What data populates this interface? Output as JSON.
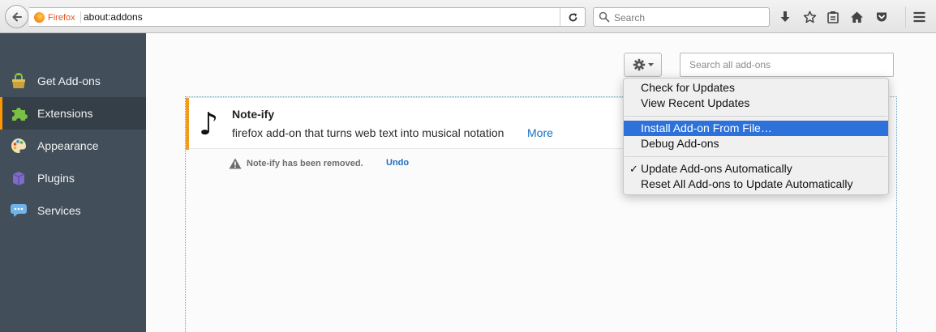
{
  "browser": {
    "identity_label": "Firefox",
    "url": "about:addons",
    "search_placeholder": "Search"
  },
  "sidebar": {
    "items": [
      {
        "label": "Get Add-ons",
        "icon": "get-addons-icon",
        "selected": false
      },
      {
        "label": "Extensions",
        "icon": "extensions-icon",
        "selected": true
      },
      {
        "label": "Appearance",
        "icon": "appearance-icon",
        "selected": false
      },
      {
        "label": "Plugins",
        "icon": "plugins-icon",
        "selected": false
      },
      {
        "label": "Services",
        "icon": "services-icon",
        "selected": false
      }
    ]
  },
  "header": {
    "search_placeholder": "Search all add-ons"
  },
  "addon": {
    "icon": "♪",
    "name": "Note-ify",
    "description": "firefox add-on that turns web text into musical notation",
    "more_label": "More"
  },
  "notice": {
    "text": "Note-ify has been removed.",
    "undo_label": "Undo"
  },
  "gear_menu": {
    "items": [
      {
        "label": "Check for Updates"
      },
      {
        "label": "View Recent Updates"
      },
      {
        "label": "Install Add-on From File…",
        "highlighted": true
      },
      {
        "label": "Debug Add-ons"
      },
      {
        "label": "Update Add-ons Automatically",
        "checked": true,
        "check_mark": "✓"
      },
      {
        "label": "Reset All Add-ons to Update Automatically"
      }
    ]
  },
  "colors": {
    "sidebar_bg": "#424f5a",
    "selected_accent": "#ff9500",
    "menu_highlight": "#2d72da",
    "link": "#1570c3"
  }
}
